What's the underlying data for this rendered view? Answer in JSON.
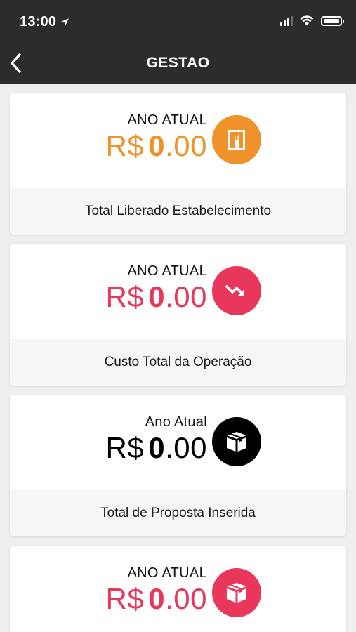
{
  "status_bar": {
    "time": "13:00"
  },
  "nav": {
    "title": "GESTAO"
  },
  "cards": [
    {
      "period": "ANO ATUAL",
      "currency": "R$",
      "amount_int": "0",
      "amount_dec": ".00",
      "label": "Total Liberado Estabelecimento",
      "color": "#f0922a",
      "icon": "document-icon"
    },
    {
      "period": "ANO ATUAL",
      "currency": "R$",
      "amount_int": "0",
      "amount_dec": ".00",
      "label": "Custo Total da Operação",
      "color": "#e8375a",
      "icon": "trend-down-icon"
    },
    {
      "period": "Ano Atual",
      "currency": "R$",
      "amount_int": "0",
      "amount_dec": ".00",
      "label": "Total de Proposta Inserida",
      "color": "#000000",
      "icon": "box-icon"
    },
    {
      "period": "ANO ATUAL",
      "currency": "R$",
      "amount_int": "0",
      "amount_dec": ".00",
      "label": "",
      "color": "#e8375a",
      "icon": "box-icon"
    }
  ]
}
